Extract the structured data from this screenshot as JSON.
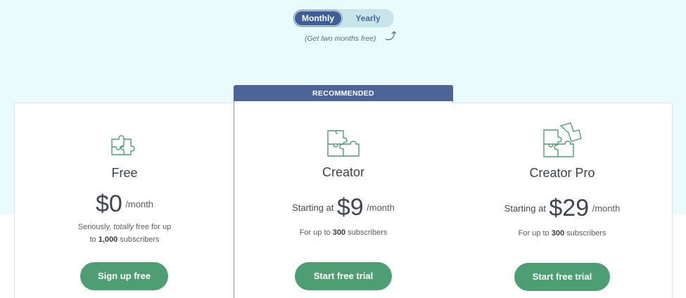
{
  "billing_toggle": {
    "monthly_label": "Monthly",
    "yearly_label": "Yearly",
    "selected": "Monthly",
    "promo": "(Get two months free)"
  },
  "recommended_label": "RECOMMENDED",
  "plans": [
    {
      "name": "Free",
      "price_prefix": "",
      "price": "$0",
      "period": "/month",
      "desc_a": "Seriously, ",
      "desc_b": "totally",
      "desc_c": " free for up",
      "desc_d": "to ",
      "desc_e": "1,000",
      "desc_f": " subscribers",
      "cta": "Sign up free",
      "icon": "puzzle-icon"
    },
    {
      "name": "Creator",
      "price_prefix": "Starting at",
      "price": "$9",
      "period": "/month",
      "desc_a": "For up to ",
      "desc_b": "300",
      "desc_c": " subscribers",
      "cta": "Start free trial",
      "icon": "puzzle-pieces-icon"
    },
    {
      "name": "Creator Pro",
      "price_prefix": "Starting at",
      "price": "$29",
      "period": "/month",
      "desc_a": "For up to ",
      "desc_b": "300",
      "desc_c": " subscribers",
      "cta": "Start free trial",
      "icon": "puzzle-assembly-icon"
    }
  ],
  "colors": {
    "accent_green": "#4e9e74",
    "banner_blue": "#4d6499",
    "toggle_active": "#3f5d97",
    "background_tint": "#eafbfb"
  }
}
